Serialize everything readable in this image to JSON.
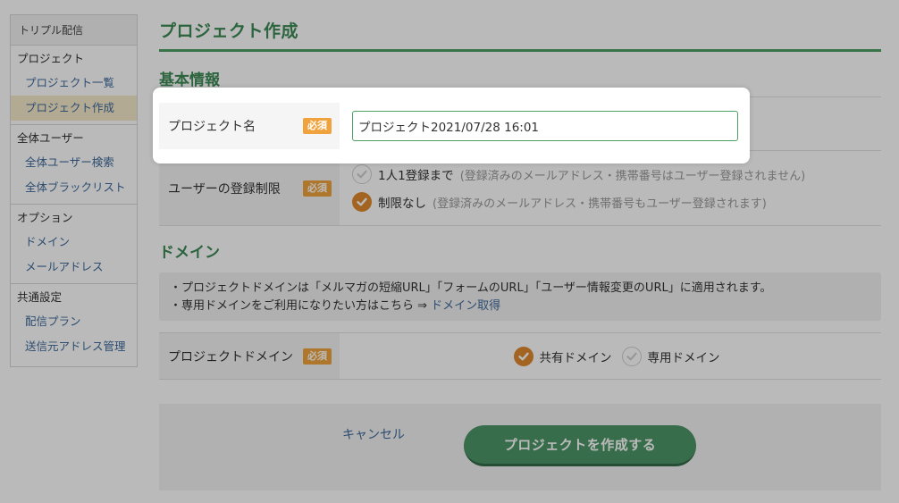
{
  "sidebar": {
    "app_name": "トリプル配信",
    "groups": [
      {
        "heading": "プロジェクト",
        "items": [
          "プロジェクト一覧",
          "プロジェクト作成"
        ]
      },
      {
        "heading": "全体ユーザー",
        "items": [
          "全体ユーザー検索",
          "全体ブラックリスト"
        ]
      },
      {
        "heading": "オプション",
        "items": [
          "ドメイン",
          "メールアドレス"
        ]
      },
      {
        "heading": "共通設定",
        "items": [
          "配信プラン",
          "送信元アドレス管理"
        ]
      }
    ],
    "active_item": "プロジェクト作成"
  },
  "main": {
    "page_title": "プロジェクト作成",
    "basic_section": {
      "title": "基本情報",
      "project_name": {
        "label": "プロジェクト名",
        "required_badge": "必須",
        "value": "プロジェクト2021/07/28 16:01"
      },
      "registration_limit": {
        "label": "ユーザーの登録制限",
        "required_badge": "必須",
        "options": [
          {
            "label": "1人1登録まで",
            "note": "(登録済みのメールアドレス・携帯番号はユーザー登録されません)",
            "selected": false
          },
          {
            "label": "制限なし",
            "note": "(登録済みのメールアドレス・携帯番号もユーザー登録されます)",
            "selected": true
          }
        ]
      }
    },
    "domain_section": {
      "title": "ドメイン",
      "info_line1": "・プロジェクトドメインは「メルマガの短縮URL」「フォームのURL」「ユーザー情報変更のURL」に適用されます。",
      "info_line2_prefix": "・専用ドメインをご利用になりたい方はこちら ⇒ ",
      "info_link": "ドメイン取得",
      "project_domain": {
        "label": "プロジェクトドメイン",
        "required_badge": "必須",
        "options": [
          {
            "label": "共有ドメイン",
            "selected": true
          },
          {
            "label": "専用ドメイン",
            "selected": false
          }
        ]
      }
    },
    "actions": {
      "cancel_label": "キャンセル",
      "create_label": "プロジェクトを作成する"
    }
  },
  "colors": {
    "accent_green": "#4d9668",
    "required_orange": "#f0a33c",
    "radio_selected": "#e08a2e",
    "link_blue": "#3f6a9b",
    "active_sidebar": "#f6eacb"
  }
}
